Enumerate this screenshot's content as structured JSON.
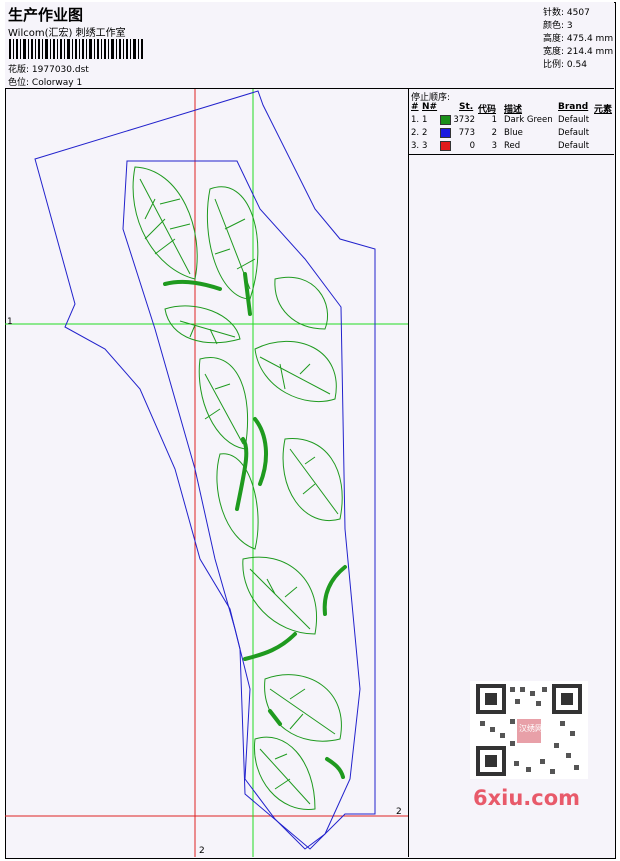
{
  "header": {
    "title": "生产作业图",
    "studio": "Wilcom(汇宏) 刺绣工作室",
    "pattern_label": "花版:",
    "pattern_value": "1977030.dst",
    "colorway_label": "色位:",
    "colorway_value": "Colorway 1"
  },
  "stats": {
    "stitches_label": "针数:",
    "stitches_value": "4507",
    "colors_label": "颜色:",
    "colors_value": "3",
    "height_label": "高度:",
    "height_value": "475.4 mm",
    "width_label": "宽度:",
    "width_value": "214.4 mm",
    "scale_label": "比例:",
    "scale_value": "0.54"
  },
  "color_table": {
    "title": "停止顺序:",
    "headers": [
      "#",
      "N#",
      "St.",
      "代码",
      "描述",
      "Brand",
      "元素"
    ],
    "rows": [
      {
        "idx": "1.",
        "n": "1",
        "color": "#1a8f1a",
        "stitches": "3732",
        "code": "1",
        "desc": "Dark Green",
        "brand": "Default"
      },
      {
        "idx": "2.",
        "n": "2",
        "color": "#1a1ae0",
        "stitches": "773",
        "code": "2",
        "desc": "Blue",
        "brand": "Default"
      },
      {
        "idx": "3.",
        "n": "3",
        "color": "#e01a1a",
        "stitches": "0",
        "code": "3",
        "desc": "Red",
        "brand": "Default"
      }
    ]
  },
  "guides": {
    "h1": "1",
    "h2": "2",
    "v2": "2"
  },
  "watermark": {
    "site": "6xiu.com",
    "badge": "汉绣网"
  },
  "palette": {
    "outline": "#2222cc",
    "stitch": "#1f9a1f",
    "guide_green": "#22dd22",
    "guide_red": "#dd2222"
  }
}
